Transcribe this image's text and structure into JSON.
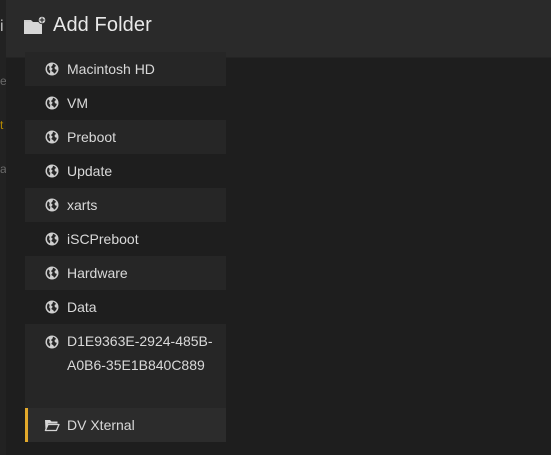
{
  "dialog": {
    "title": "Add Folder",
    "icon": "folder-add-icon"
  },
  "behind": {
    "glyphs": [
      "i",
      "e",
      "t",
      "a"
    ]
  },
  "folders": [
    {
      "label": "Macintosh HD",
      "icon": "globe-icon"
    },
    {
      "label": "VM",
      "icon": "globe-icon"
    },
    {
      "label": "Preboot",
      "icon": "globe-icon"
    },
    {
      "label": "Update",
      "icon": "globe-icon"
    },
    {
      "label": "xarts",
      "icon": "globe-icon"
    },
    {
      "label": "iSCPreboot",
      "icon": "globe-icon"
    },
    {
      "label": "Hardware",
      "icon": "globe-icon"
    },
    {
      "label": "Data",
      "icon": "globe-icon"
    },
    {
      "label": "D1E9363E-2924-485B-A0B6-35E1B840C889",
      "icon": "globe-icon"
    },
    {
      "label": "DV Xternal",
      "icon": "folder-open-icon"
    }
  ],
  "selected_index": 9,
  "colors": {
    "accent": "#e3a92b",
    "text": "#d9d9d9",
    "header_bg": "#2a2a2a"
  }
}
